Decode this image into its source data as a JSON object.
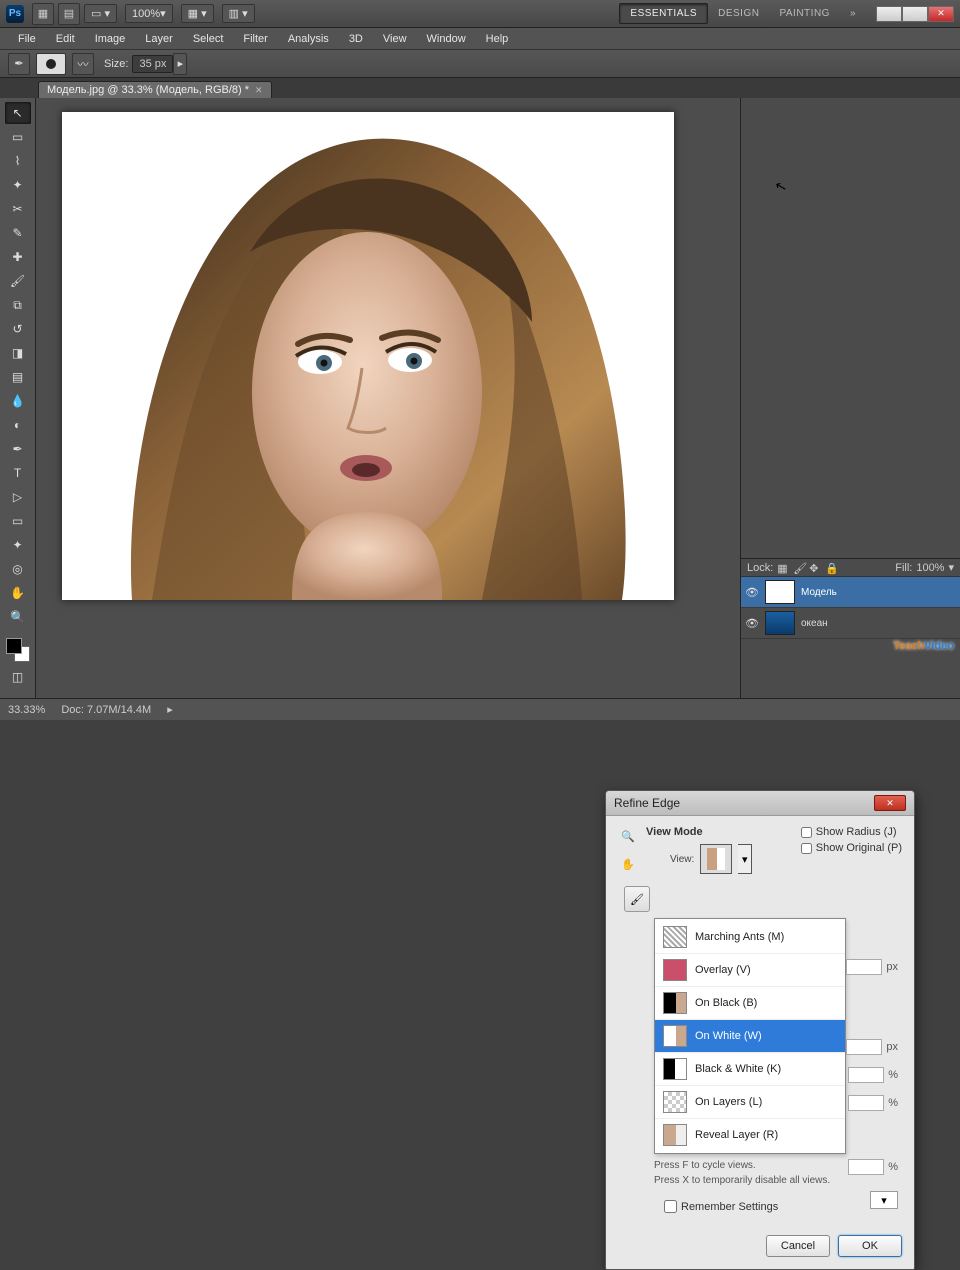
{
  "app": {
    "ps": "Ps",
    "zoom_dd": "100%"
  },
  "workspace": {
    "essentials": "ESSENTIALS",
    "design": "DESIGN",
    "painting": "PAINTING"
  },
  "menu": [
    "File",
    "Edit",
    "Image",
    "Layer",
    "Select",
    "Filter",
    "Analysis",
    "3D",
    "View",
    "Window",
    "Help"
  ],
  "options": {
    "size_label": "Size:",
    "size_value": "35 px"
  },
  "document": {
    "tab": "Модель.jpg @ 33.3% (Модель, RGB/8) *"
  },
  "dialog": {
    "title": "Refine Edge",
    "view_mode_label": "View Mode",
    "view_label": "View:",
    "show_radius": "Show Radius (J)",
    "show_original": "Show Original (P)",
    "items": [
      {
        "label": "Marching Ants (M)",
        "cls": "ants"
      },
      {
        "label": "Overlay (V)",
        "cls": "ovl"
      },
      {
        "label": "On Black (B)",
        "cls": "blk"
      },
      {
        "label": "On White (W)",
        "cls": "wht"
      },
      {
        "label": "Black & White (K)",
        "cls": "bw"
      },
      {
        "label": "On Layers (L)",
        "cls": "lyr"
      },
      {
        "label": "Reveal Layer (R)",
        "cls": "rev"
      }
    ],
    "hint1": "Press F to cycle views.",
    "hint2": "Press X to temporarily disable all views.",
    "remember": "Remember Settings",
    "cancel": "Cancel",
    "ok": "OK",
    "unit_px": "px",
    "unit_pct": "%"
  },
  "layers": {
    "lock_label": "Lock:",
    "fill_label": "Fill:",
    "fill_value": "100%",
    "layer1": "Модель",
    "layer2": "океан"
  },
  "status": {
    "zoom": "33.33%",
    "doc": "Doc: 7.07M/14.4M"
  },
  "watermark": {
    "a": "Teach",
    "b": "Video"
  }
}
